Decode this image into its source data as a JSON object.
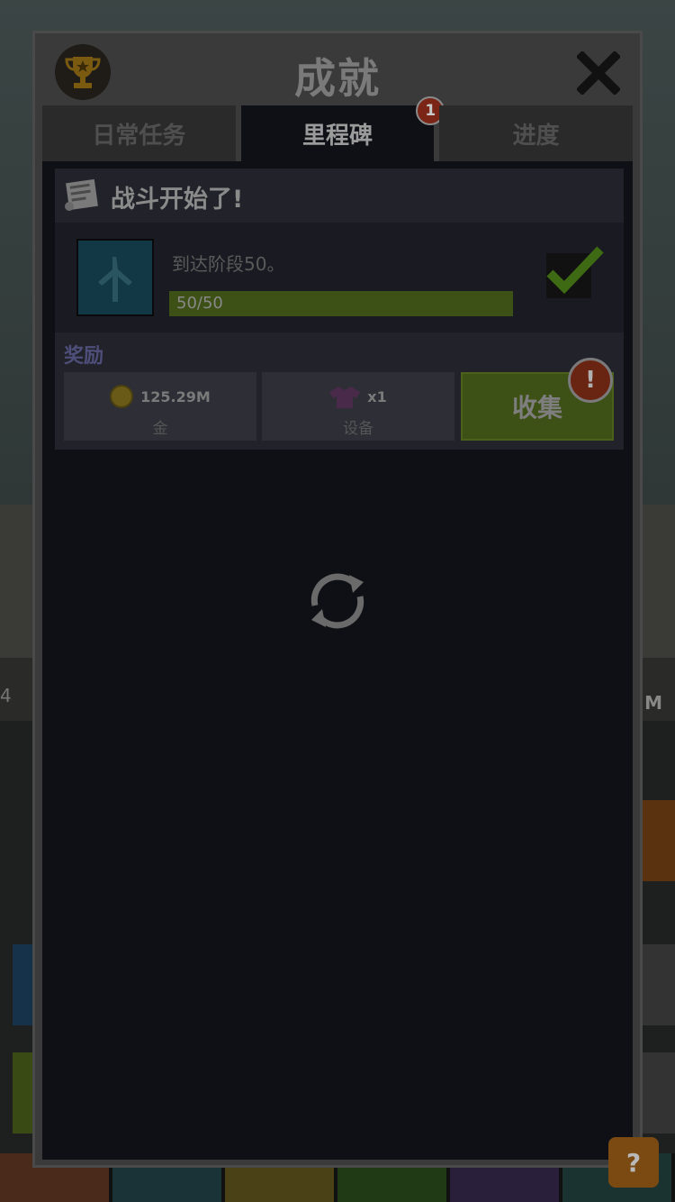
{
  "panel": {
    "title": "成就",
    "close_icon": "close-icon",
    "trophy_icon": "trophy-icon"
  },
  "tabs": [
    {
      "label": "日常任务",
      "active": false
    },
    {
      "label": "里程碑",
      "active": true,
      "badge": "1"
    },
    {
      "label": "进度",
      "active": false
    }
  ],
  "achievement": {
    "title": "战斗开始了!",
    "description": "到达阶段50。",
    "progress_text": "50/50",
    "progress": 1.0,
    "completed": true
  },
  "rewards": {
    "label": "奖励",
    "items": [
      {
        "icon": "gold-coin-icon",
        "value": "125.29M",
        "label": "金"
      },
      {
        "icon": "shirt-icon",
        "value": "x1",
        "label": "设备"
      }
    ],
    "collect_label": "收集",
    "alert": "!"
  },
  "background": {
    "left_text": "4",
    "right_text": "M",
    "help_label": "?"
  },
  "colors": {
    "accent_green": "#3d5016",
    "badge_red": "#7a2516",
    "panel_bg": "#0f1016"
  }
}
